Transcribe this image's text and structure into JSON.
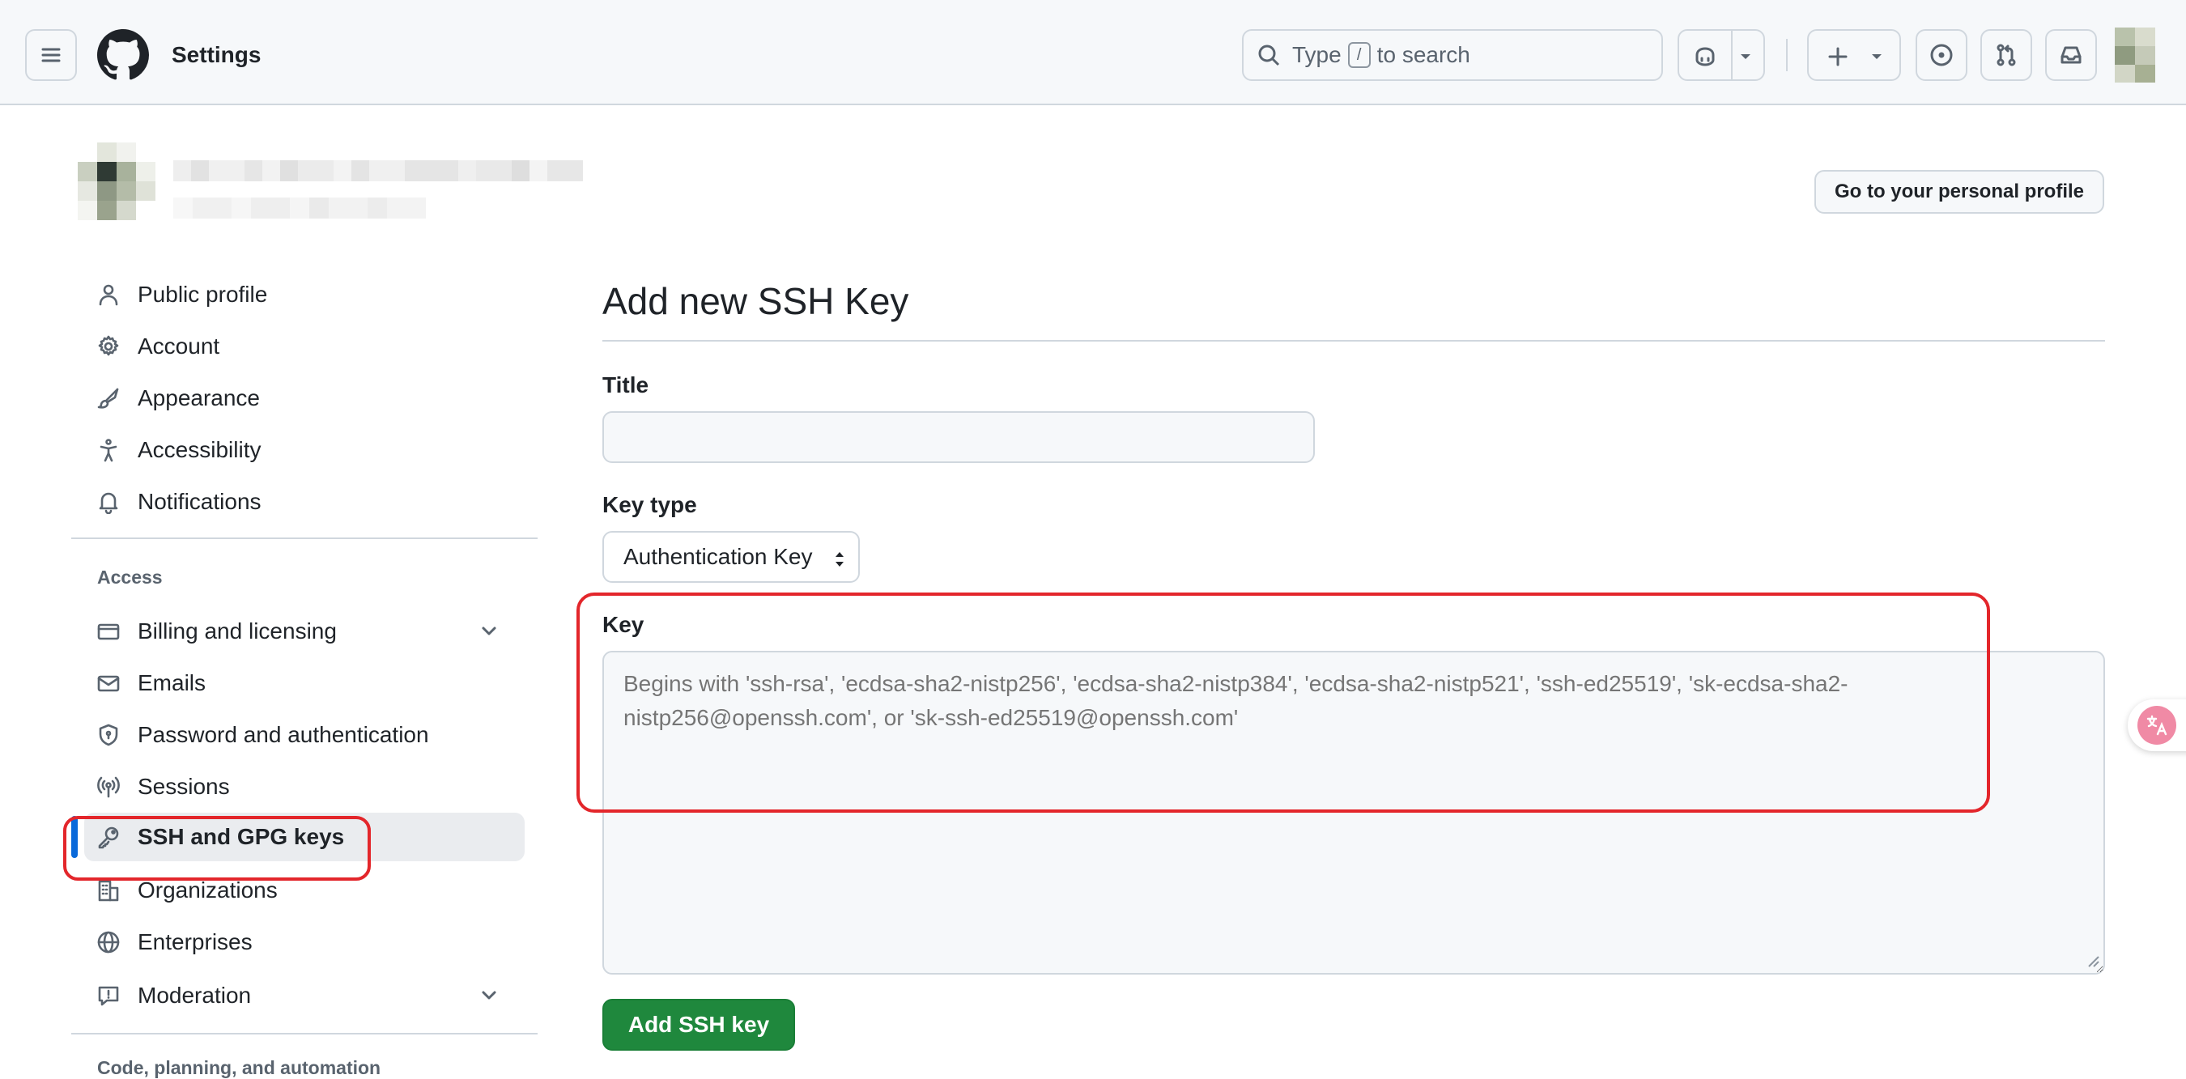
{
  "header": {
    "title": "Settings",
    "search_prefix": "Type",
    "search_key": "/",
    "search_suffix": "to search"
  },
  "profile_button": "Go to your personal profile",
  "sidebar": {
    "items_top": [
      {
        "label": "Public profile",
        "icon": "person-icon"
      },
      {
        "label": "Account",
        "icon": "gear-icon"
      },
      {
        "label": "Appearance",
        "icon": "paintbrush-icon"
      },
      {
        "label": "Accessibility",
        "icon": "accessibility-icon"
      },
      {
        "label": "Notifications",
        "icon": "bell-icon"
      }
    ],
    "section_access": "Access",
    "items_access": [
      {
        "label": "Billing and licensing",
        "icon": "credit-card-icon",
        "expandable": true
      },
      {
        "label": "Emails",
        "icon": "mail-icon"
      },
      {
        "label": "Password and authentication",
        "icon": "shield-lock-icon"
      },
      {
        "label": "Sessions",
        "icon": "broadcast-icon"
      },
      {
        "label": "SSH and GPG keys",
        "icon": "key-icon",
        "active": true
      },
      {
        "label": "Organizations",
        "icon": "organization-icon"
      },
      {
        "label": "Enterprises",
        "icon": "globe-icon"
      },
      {
        "label": "Moderation",
        "icon": "report-icon",
        "expandable": true
      }
    ],
    "section_code": "Code, planning, and automation"
  },
  "main": {
    "page_title": "Add new SSH Key",
    "title_label": "Title",
    "title_value": "",
    "key_type_label": "Key type",
    "key_type_value": "Authentication Key",
    "key_label": "Key",
    "key_placeholder": "Begins with 'ssh-rsa', 'ecdsa-sha2-nistp256', 'ecdsa-sha2-nistp384', 'ecdsa-sha2-nistp521', 'ssh-ed25519', 'sk-ecdsa-sha2-nistp256@openssh.com', or 'sk-ssh-ed25519@openssh.com'",
    "submit_label": "Add SSH key"
  },
  "colors": {
    "accent_blue": "#0969da",
    "primary_green": "#1f883d",
    "annotation_red": "#e3262b"
  }
}
